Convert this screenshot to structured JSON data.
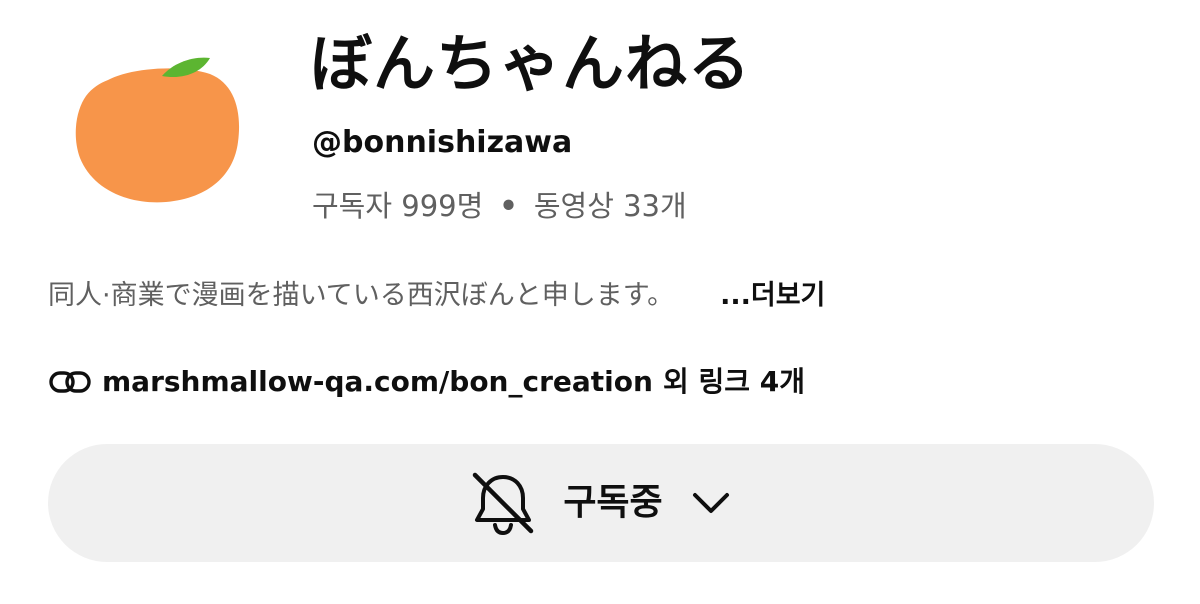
{
  "channel": {
    "name": "ぼんちゃんねる",
    "handle": "@bonnishizawa",
    "subscribers": "구독자 999명",
    "separator": "•",
    "videos": "동영상 33개"
  },
  "description": {
    "text": "同人·商業で漫画を描いている西沢ぼんと申します。",
    "more_label": "...더보기"
  },
  "links": {
    "primary": "marshmallow-qa.com/bon_creation",
    "extra": "외 링크 4개",
    "icon": "link-icon"
  },
  "subscribe": {
    "label": "구독중",
    "bell_icon": "bell-off-icon",
    "chevron_icon": "chevron-down-icon"
  },
  "avatar": {
    "icon": "tangerine",
    "colors": {
      "fruit": "#f7954a",
      "leaf": "#5cb531"
    }
  }
}
